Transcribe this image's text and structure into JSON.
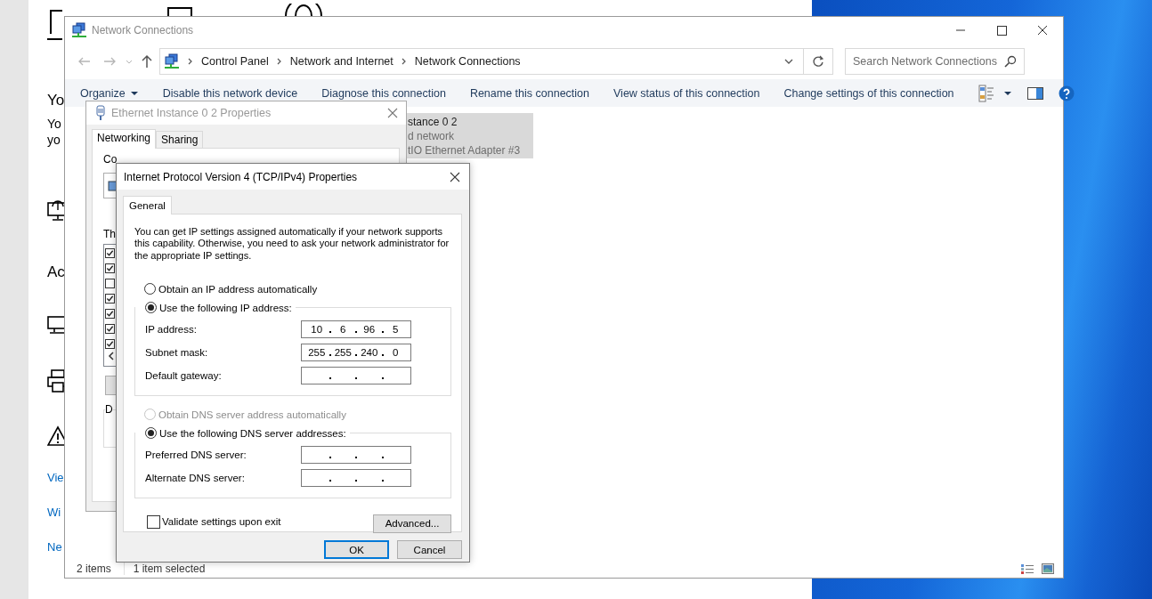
{
  "settings_page": {
    "heading": "Yo",
    "text_lines": [
      "Yo",
      "yo"
    ],
    "heading_2": "Ac",
    "links": [
      "Vie",
      "Wi",
      "Ne"
    ]
  },
  "explorer": {
    "title": "Network Connections",
    "breadcrumb": [
      "Control Panel",
      "Network and Internet",
      "Network Connections"
    ],
    "search": {
      "placeholder": "Search Network Connections"
    },
    "toolbar": [
      {
        "label": "Organize",
        "kind": "menu"
      },
      {
        "label": "Disable this network device",
        "kind": "command"
      },
      {
        "label": "Diagnose this connection",
        "kind": "command"
      },
      {
        "label": "Rename this connection",
        "kind": "command"
      },
      {
        "label": "View status of this connection",
        "kind": "command"
      },
      {
        "label": "Change settings of this connection",
        "kind": "command"
      }
    ],
    "connection": {
      "selected": true,
      "name": "stance 0 2",
      "status": "d network",
      "device": "tIO Ethernet Adapter #3"
    },
    "status_bar": {
      "item_count": "2 items",
      "selection": "1 item selected"
    }
  },
  "ethernet_dialog": {
    "title": "Ethernet Instance 0 2 Properties",
    "tabs": [
      {
        "label": "Networking",
        "selected": true
      },
      {
        "label": "Sharing",
        "selected": false
      }
    ],
    "connect_label": "Co",
    "items_label": "Th",
    "items": [
      {
        "checked": true
      },
      {
        "checked": true
      },
      {
        "checked": false
      },
      {
        "checked": true
      },
      {
        "checked": true
      },
      {
        "checked": true
      },
      {
        "checked": true
      }
    ],
    "group_label": "D"
  },
  "ipv4_dialog": {
    "title": "Internet Protocol Version 4 (TCP/IPv4) Properties",
    "tabs": [
      {
        "label": "General",
        "selected": true
      }
    ],
    "description": "You can get IP settings assigned automatically if your network supports this capability. Otherwise, you need to ask your network administrator for the appropriate IP settings.",
    "ip_modes": [
      {
        "label": "Obtain an IP address automatically",
        "selected": false,
        "disabled": false
      },
      {
        "label": "Use the following IP address:",
        "selected": true,
        "disabled": false
      }
    ],
    "ip_fields": [
      {
        "label": "IP address:",
        "octets": [
          "10",
          "6",
          "96",
          "5"
        ]
      },
      {
        "label": "Subnet mask:",
        "octets": [
          "255",
          "255",
          "240",
          "0"
        ]
      },
      {
        "label": "Default gateway:"
      }
    ],
    "dns_modes": [
      {
        "label": "Obtain DNS server address automatically",
        "selected": false,
        "disabled": true
      },
      {
        "label": "Use the following DNS server addresses:",
        "selected": true,
        "disabled": false
      }
    ],
    "dns_fields": [
      {
        "label": "Preferred DNS server:"
      },
      {
        "label": "Alternate DNS server:"
      }
    ],
    "validate": {
      "label": "Validate settings upon exit",
      "checked": false
    },
    "advanced_button": "Advanced...",
    "buttons": [
      {
        "label": "OK",
        "kind": "default"
      },
      {
        "label": "Cancel",
        "kind": "normal"
      }
    ]
  }
}
